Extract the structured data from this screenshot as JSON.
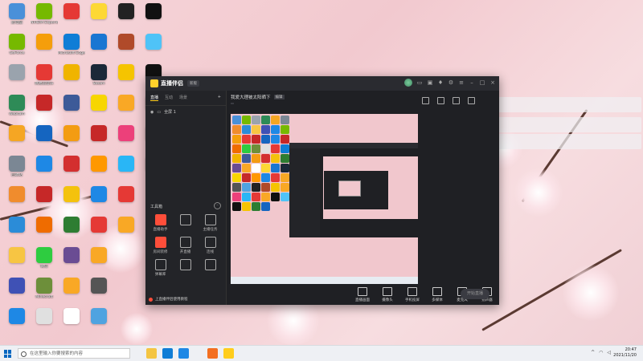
{
  "desktop": {
    "icons": [
      {
        "label": "此电脑",
        "color": "#4a90d9"
      },
      {
        "label": "GeForce",
        "color": "#76b900"
      },
      {
        "label": "",
        "color": "#9aa3ad"
      },
      {
        "label": "Webcam",
        "color": "#2e8b57"
      },
      {
        "label": "",
        "color": "#f5a623"
      },
      {
        "label": "回收站",
        "color": "#7b8794"
      },
      {
        "label": "",
        "color": "#f08c2d"
      },
      {
        "label": "",
        "color": "#2b8cd8"
      },
      {
        "label": "",
        "color": "#f7c543"
      },
      {
        "label": "",
        "color": "#3f51b5"
      },
      {
        "label": "",
        "color": "#1e88e5"
      },
      {
        "label": "NVIDIA Experience",
        "color": "#76b900"
      },
      {
        "label": "",
        "color": "#f59e0b"
      },
      {
        "label": "网易云音乐",
        "color": "#e53935"
      },
      {
        "label": "",
        "color": "#c62828"
      },
      {
        "label": "",
        "color": "#1565c0"
      },
      {
        "label": "",
        "color": "#1e88e5"
      },
      {
        "label": "",
        "color": "#c62828"
      },
      {
        "label": "",
        "color": "#ef6c00"
      },
      {
        "label": "微信",
        "color": "#2ecc40"
      },
      {
        "label": "Minecraft",
        "color": "#6d8f3a"
      },
      {
        "label": "",
        "color": "#e0e0e0"
      },
      {
        "label": "",
        "color": "#e53935"
      },
      {
        "label": "Microsoft Edge",
        "color": "#0f7dd6"
      },
      {
        "label": "",
        "color": "#f0b400"
      },
      {
        "label": "",
        "color": "#3d5a98"
      },
      {
        "label": "",
        "color": "#f39c12"
      },
      {
        "label": "",
        "color": "#d32f2f"
      },
      {
        "label": "",
        "color": "#f4c20d"
      },
      {
        "label": "",
        "color": "#2e7d32"
      },
      {
        "label": "",
        "color": "#6a4c93"
      },
      {
        "label": "",
        "color": "#f9a825"
      },
      {
        "label": "",
        "color": "#ffffff"
      },
      {
        "label": "",
        "color": "#fdd835"
      },
      {
        "label": "",
        "color": "#1976d2"
      },
      {
        "label": "Steam",
        "color": "#1b2838"
      },
      {
        "label": "",
        "color": "#f7d600"
      },
      {
        "label": "",
        "color": "#c62828"
      },
      {
        "label": "",
        "color": "#ff9800"
      },
      {
        "label": "",
        "color": "#1e88e5"
      },
      {
        "label": "",
        "color": "#e53935"
      },
      {
        "label": "",
        "color": "#f9a825"
      },
      {
        "label": "",
        "color": "#555555"
      },
      {
        "label": "",
        "color": "#4fa3e0"
      },
      {
        "label": "",
        "color": "#222222"
      },
      {
        "label": "",
        "color": "#b04a2a"
      },
      {
        "label": "",
        "color": "#f5c400"
      },
      {
        "label": "",
        "color": "#f9a825"
      },
      {
        "label": "",
        "color": "#ec407a"
      },
      {
        "label": "",
        "color": "#29b6f6"
      },
      {
        "label": "",
        "color": "#e53935"
      },
      {
        "label": "",
        "color": "#f9a825"
      },
      {
        "label": "",
        "color": "#111111"
      },
      {
        "label": "",
        "color": "#4fc3f7"
      },
      {
        "label": "",
        "color": "#111111"
      },
      {
        "label": "",
        "color": "#f5c400"
      },
      {
        "label": "",
        "color": "#2e7d32"
      },
      {
        "label": "",
        "color": "#1565c0"
      }
    ]
  },
  "app": {
    "name": "直播伴侣",
    "version_badge": "新版",
    "left_tabs": [
      "直播",
      "互动",
      "场景"
    ],
    "scene_label": "全屏 1",
    "tools_title": "工具箱",
    "tools": [
      "",
      "直播助手",
      "主播任务",
      "房间装修",
      "开直播",
      "连线",
      "弹幕库",
      "",
      "",
      "",
      "",
      ""
    ],
    "notice": "上直播伴侣使用教程",
    "channel": {
      "title": "我爱大理被太阳晒下",
      "edit": "编辑",
      "tags": [
        "",
        "",
        "",
        ""
      ]
    },
    "controls": [
      "直播画面",
      "摄像头",
      "手机投屏",
      "多媒体",
      "麦克风",
      "扬声器"
    ],
    "start_label": "开始直播",
    "stats": [
      "",
      "",
      "",
      "",
      "",
      "",
      ""
    ]
  },
  "toasts": [
    "",
    "",
    ""
  ],
  "taskbar": {
    "search_placeholder": "在这里输入你要搜索的内容",
    "time": "20:47",
    "date": "2021/11/20",
    "apps": [
      {
        "name": "file-explorer",
        "color": "#f4c542"
      },
      {
        "name": "edge",
        "color": "#0f7dd6"
      },
      {
        "name": "app-blue",
        "color": "#1e88e5"
      },
      {
        "name": "app-orange",
        "color": "#f36f21"
      },
      {
        "name": "app-live",
        "color": "#ffcd1c"
      }
    ]
  }
}
